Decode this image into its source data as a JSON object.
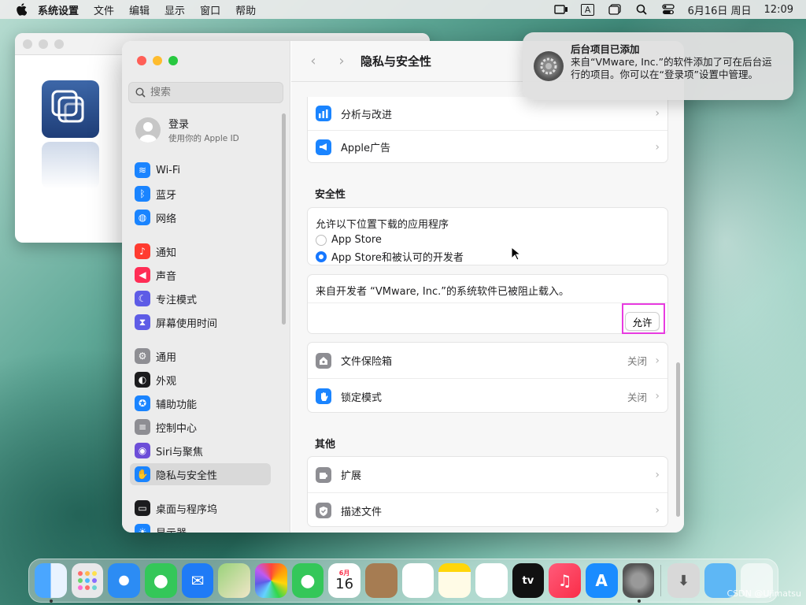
{
  "menubar": {
    "app": "系统设置",
    "items": [
      "文件",
      "编辑",
      "显示",
      "窗口",
      "帮助"
    ],
    "input_indicator": "A",
    "date": "6月16日 周日",
    "time": "12:09"
  },
  "window": {
    "search": {
      "placeholder": "搜索"
    },
    "account": {
      "title": "登录",
      "subtitle": "使用你的 Apple ID"
    },
    "sidebar": [
      {
        "label": "Wi-Fi",
        "icon": "wifi-icon",
        "color": "#1a84ff"
      },
      {
        "label": "蓝牙",
        "icon": "bluetooth-icon",
        "color": "#1a84ff"
      },
      {
        "label": "网络",
        "icon": "globe-icon",
        "color": "#1a84ff"
      },
      {
        "label": "通知",
        "icon": "bell-icon",
        "color": "#ff3b30"
      },
      {
        "label": "声音",
        "icon": "speaker-icon",
        "color": "#ff2d55"
      },
      {
        "label": "专注模式",
        "icon": "moon-icon",
        "color": "#5e5ce6"
      },
      {
        "label": "屏幕使用时间",
        "icon": "hourglass-icon",
        "color": "#5e5ce6"
      },
      {
        "label": "通用",
        "icon": "gear-icon",
        "color": "#8e8e93"
      },
      {
        "label": "外观",
        "icon": "appearance-icon",
        "color": "#1c1c1e"
      },
      {
        "label": "辅助功能",
        "icon": "accessibility-icon",
        "color": "#1a84ff"
      },
      {
        "label": "控制中心",
        "icon": "toggles-icon",
        "color": "#8e8e93"
      },
      {
        "label": "Siri与聚焦",
        "icon": "siri-icon",
        "color": "#6d4ed8"
      },
      {
        "label": "隐私与安全性",
        "icon": "hand-icon",
        "color": "#1a84ff",
        "selected": true
      },
      {
        "label": "桌面与程序坞",
        "icon": "dock-icon",
        "color": "#1c1c1e"
      },
      {
        "label": "显示器",
        "icon": "sun-icon",
        "color": "#1a84ff"
      }
    ],
    "title": "隐私与安全性",
    "privacy_rows": [
      {
        "label": "分析与改进",
        "icon": "chart-icon"
      },
      {
        "label": "Apple广告",
        "icon": "megaphone-icon"
      }
    ],
    "security": {
      "heading": "安全性",
      "allow_label": "允许以下位置下载的应用程序",
      "options": [
        {
          "label": "App Store",
          "selected": false
        },
        {
          "label": "App Store和被认可的开发者",
          "selected": true
        }
      ],
      "blocked_message": "来自开发者 “VMware, Inc.”的系统软件已被阻止载入。",
      "allow_button": "允许",
      "rows": [
        {
          "label": "文件保险箱",
          "value": "关闭",
          "icon": "house-icon"
        },
        {
          "label": "锁定模式",
          "value": "关闭",
          "icon": "hand-icon"
        }
      ]
    },
    "other": {
      "heading": "其他",
      "rows": [
        {
          "label": "扩展",
          "icon": "puzzle-icon"
        },
        {
          "label": "描述文件",
          "icon": "checkmark-shield-icon"
        }
      ]
    }
  },
  "notification": {
    "title": "后台项目已添加",
    "body": "来自“VMware, Inc.”的软件添加了可在后台运行的项目。你可以在“登录项”设置中管理。"
  },
  "dock": [
    "访达",
    "启动台",
    "Safari浏览器",
    "信息",
    "邮件",
    "地图",
    "照片",
    "FaceTime通话",
    "日历",
    "通讯录",
    "提醒事项",
    "备忘录",
    "无边记",
    "tv",
    "音乐",
    "App Store",
    "系统设置",
    "下载",
    "文件夹",
    "废纸篓"
  ],
  "dock_calendar": {
    "month": "6月",
    "day": "16"
  },
  "watermark": "CSDN @Ujimatsu"
}
